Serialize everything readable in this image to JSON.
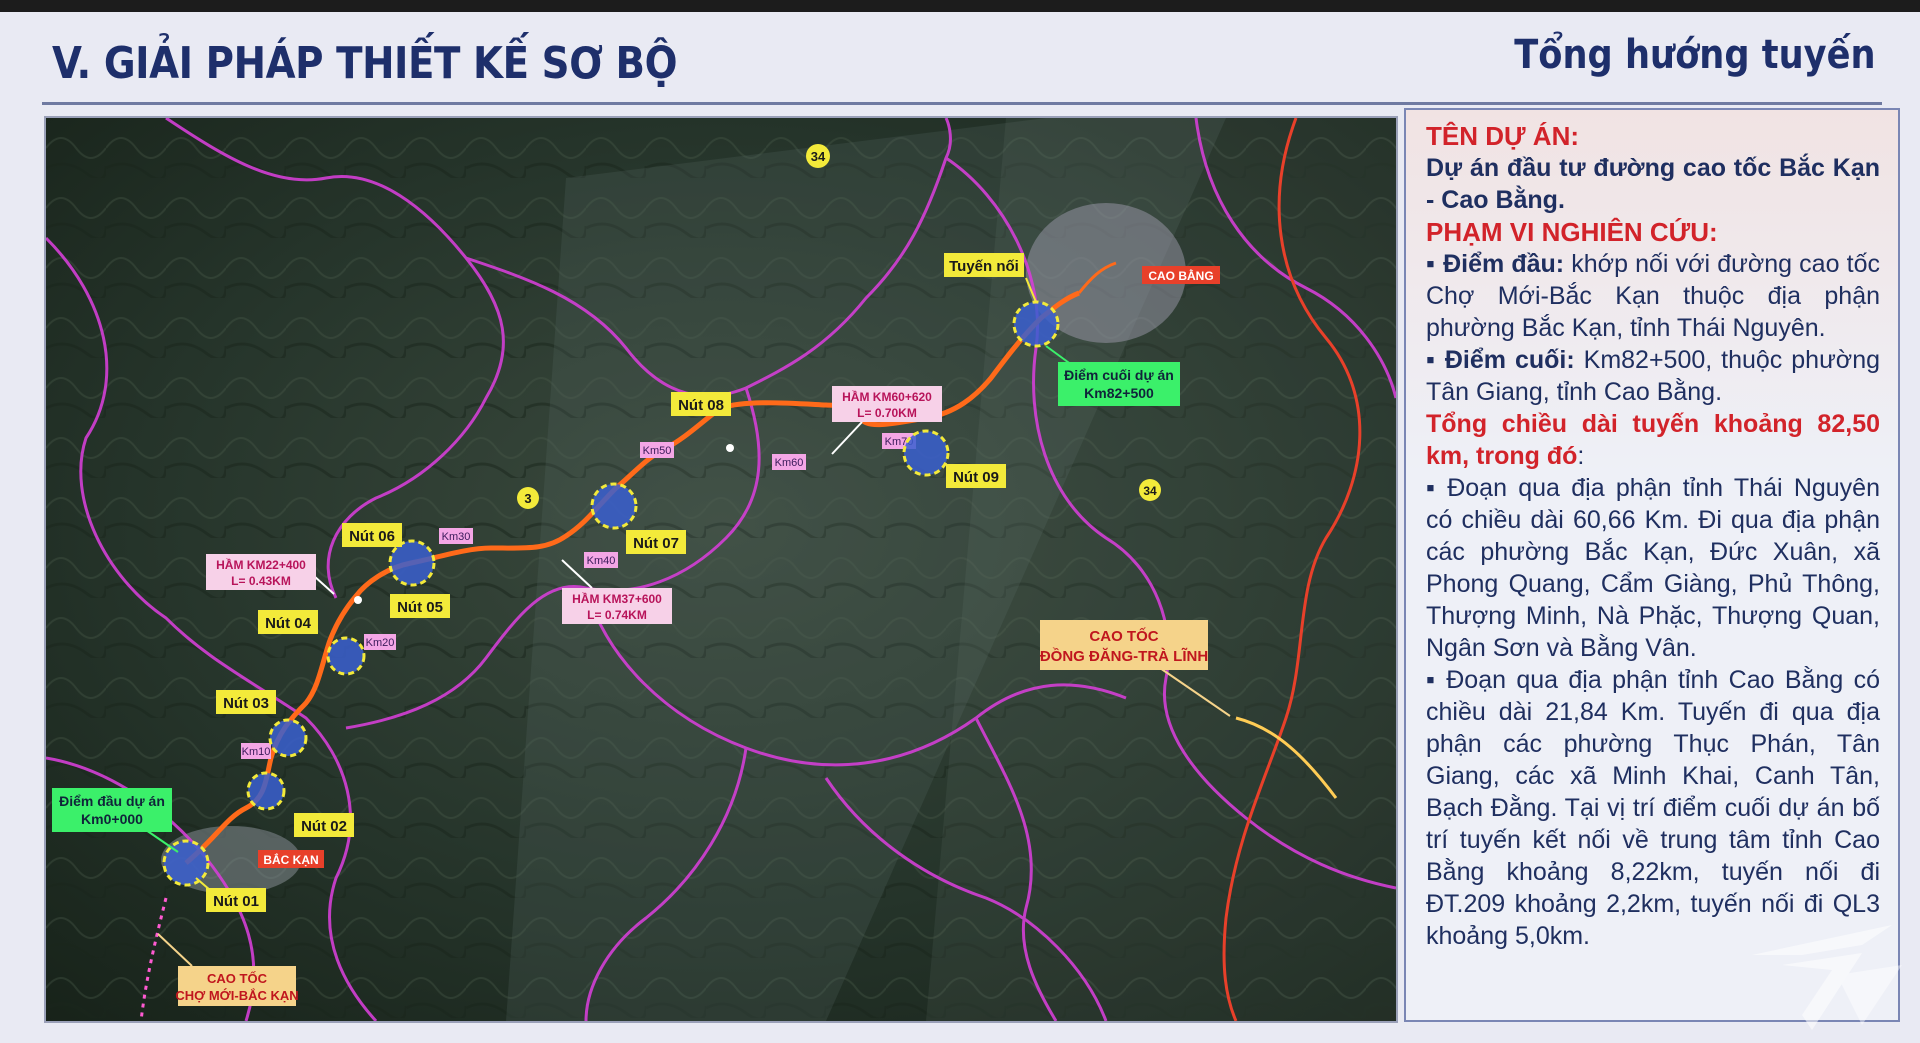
{
  "header": {
    "title": "V. GIẢI PHÁP THIẾT KẾ SƠ BỘ",
    "subtitle": "Tổng hướng tuyến"
  },
  "map": {
    "start_label": [
      "Điểm đầu dự án",
      "Km0+000"
    ],
    "end_label": [
      "Điểm cuối dự án",
      "Km82+500"
    ],
    "connector_label": "Tuyến nối",
    "cities": {
      "bac_kan": "BẮC KẠN",
      "cao_bang": "CAO BẰNG"
    },
    "junctions": [
      "Nút 01",
      "Nút 02",
      "Nút 03",
      "Nút 04",
      "Nút 05",
      "Nút 06",
      "Nút 07",
      "Nút 08",
      "Nút 09"
    ],
    "km_marks": [
      "Km10",
      "Km20",
      "Km30",
      "Km40",
      "Km50",
      "Km60",
      "Km70"
    ],
    "tunnels": [
      [
        "HẦM KM22+400",
        "L= 0.43KM"
      ],
      [
        "HẦM KM37+600",
        "L= 0.74KM"
      ],
      [
        "HẦM KM60+620",
        "L= 0.70KM"
      ]
    ],
    "expressways": [
      [
        "CAO TỐC",
        "CHỢ MỚI-BẮC KẠN"
      ],
      [
        "CAO TỐC",
        "ĐỒNG ĐĂNG-TRÀ LĨNH"
      ]
    ],
    "road_numbers": [
      "34",
      "3",
      "34"
    ],
    "colors": {
      "route": "#ff6a1a",
      "border": "#d43fd6",
      "province_border": "#e8402a",
      "node_fill": "#3a5fcf",
      "label_yellow": "#f3ea3a",
      "label_green": "#3bf06a"
    }
  },
  "info": {
    "project_heading": "TÊN DỰ ÁN:",
    "project_name": "Dự án đầu tư đường cao tốc Bắc Kạn - Cao Bằng.",
    "scope_heading": "PHẠM VI NGHIÊN CỨU:",
    "start_point_label": "Điểm đầu:",
    "start_point_text": "khớp nối với đường cao tốc Chợ Mới-Bắc Kạn thuộc địa phận phường Bắc Kạn, tỉnh Thái Nguyên.",
    "end_point_label": "Điểm cuối:",
    "end_point_text": "Km82+500, thuộc phường Tân Giang, tỉnh Cao Bằng.",
    "total_length": "Tổng chiều dài tuyến khoảng 82,50 km, trong đó",
    "total_length_suffix": ":",
    "segment_1": "Đoạn qua địa phận tỉnh Thái Nguyên có chiều dài 60,66 Km. Đi qua địa phận các phường Bắc Kạn, Đức Xuân, xã Phong Quang, Cẩm Giàng, Phủ Thông, Thượng Minh, Nà Phặc, Thượng Quan, Ngân Sơn và Bằng Vân.",
    "segment_2": "Đoạn qua địa phận tỉnh Cao Bằng có chiều dài 21,84 Km. Tuyến đi qua địa phận các phường Thục Phán, Tân Giang, các xã Minh Khai, Canh Tân, Bạch Đằng. Tại vị trí điểm cuối dự án bố trí tuyến kết nối về trung tâm tỉnh Cao Bằng khoảng 8,22km, tuyến nối đi ĐT.209 khoảng 2,2km, tuyến nối đi QL3 khoảng 5,0km."
  }
}
